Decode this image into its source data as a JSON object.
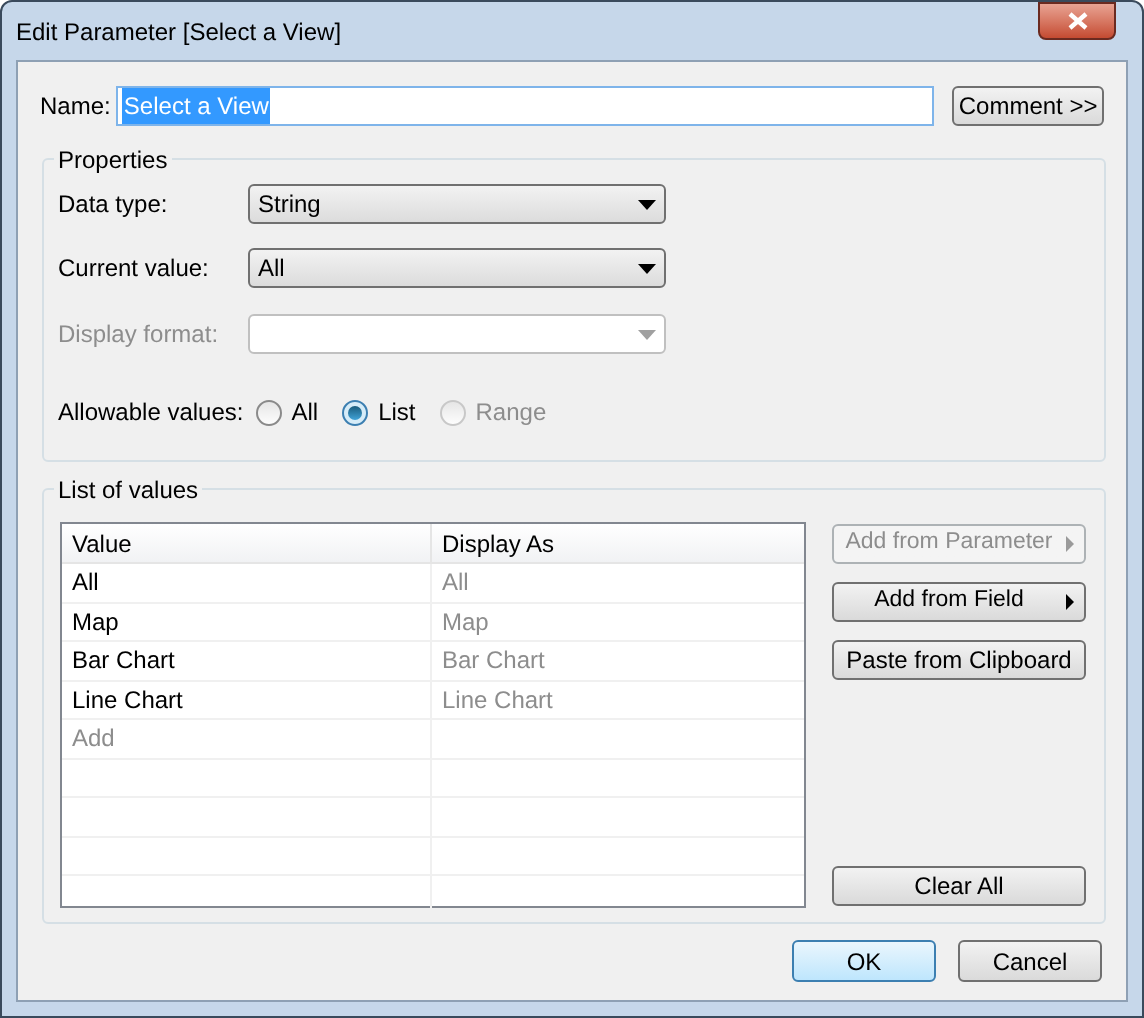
{
  "window": {
    "title": "Edit Parameter [Select a View]"
  },
  "name": {
    "label": "Name:",
    "value": "Select a View",
    "selected": true
  },
  "comment_button": {
    "label": "Comment >>"
  },
  "properties": {
    "title": "Properties",
    "fields": [
      {
        "label": "Data type:",
        "value": "String",
        "disabled": false
      },
      {
        "label": "Current value:",
        "value": "All",
        "disabled": false
      },
      {
        "label": "Display format:",
        "disabled": true
      }
    ],
    "allowable_values": {
      "label": "Allowable values:",
      "options": [
        {
          "label": "All",
          "selected": false,
          "disabled": false
        },
        {
          "label": "List",
          "selected": true,
          "disabled": false
        },
        {
          "label": "Range",
          "selected": false,
          "disabled": true
        }
      ]
    }
  },
  "list_of_values": {
    "title": "List of values",
    "table": {
      "columns": [
        "Value",
        "Display As"
      ],
      "rows": [
        {
          "kind": "entry",
          "value": "All",
          "display_as": "All"
        },
        {
          "kind": "entry",
          "value": "Map",
          "display_as": "Map"
        },
        {
          "kind": "entry",
          "value": "Bar Chart",
          "display_as": "Bar Chart"
        },
        {
          "kind": "entry",
          "value": "Line Chart",
          "display_as": "Line Chart"
        },
        {
          "kind": "new",
          "value": "Add"
        }
      ]
    },
    "side_buttons": [
      {
        "label": "Add from Parameter",
        "disabled": true,
        "submenu": true
      },
      {
        "label": "Add from Field",
        "disabled": false,
        "submenu": true
      },
      {
        "label": "Paste from Clipboard",
        "disabled": false,
        "submenu": false
      }
    ],
    "clear_button": {
      "label": "Clear All",
      "disabled": false
    }
  },
  "footer_buttons": [
    {
      "label": "OK",
      "default": true
    },
    {
      "label": "Cancel",
      "default": false
    }
  ]
}
